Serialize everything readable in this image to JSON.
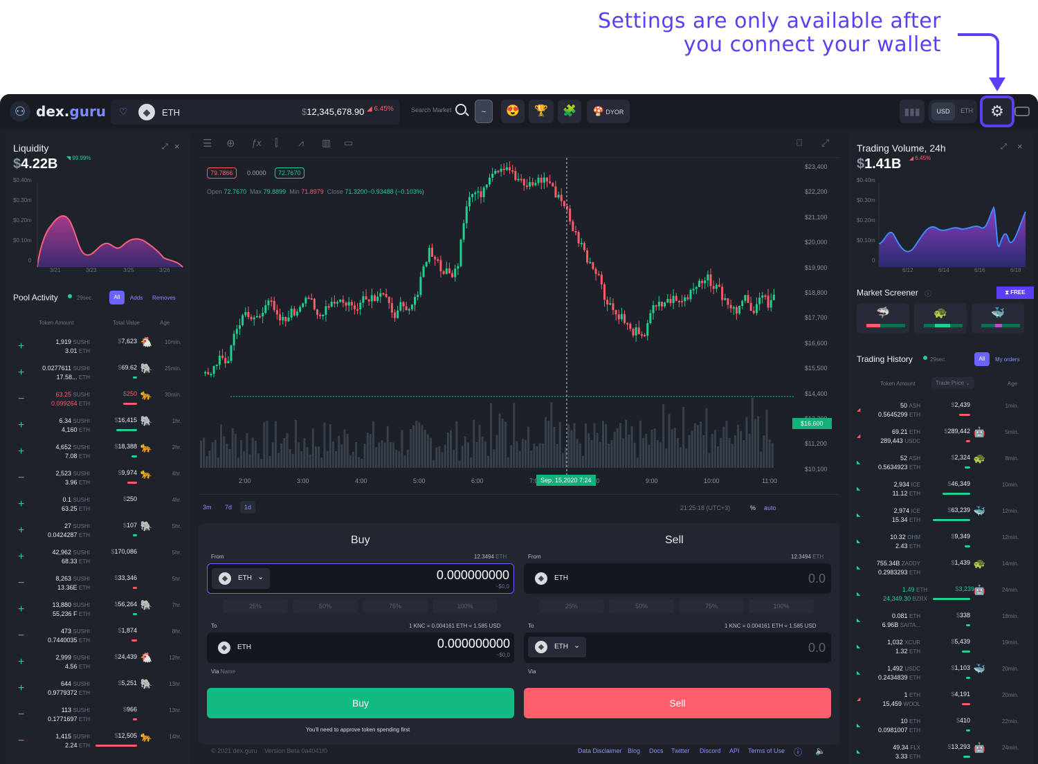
{
  "callout": {
    "line1": "Settings are only available after",
    "line2": "you connect your wallet"
  },
  "header": {
    "logo_a": "dex.",
    "logo_b": "guru",
    "token": "ETH",
    "price": "12,345,678.90",
    "price_prefix": "$",
    "change": "6.45%",
    "search": "Search Market",
    "dyor": "DYOR",
    "currencies": [
      "USD",
      "ETH"
    ]
  },
  "liquidity": {
    "title": "Liquidity",
    "value": "4.22B",
    "prefix": "$",
    "change": "99.99%",
    "yticks": [
      "$0.40m",
      "$0.30m",
      "$0.20m",
      "$0.10m",
      "0"
    ],
    "xticks": [
      "3/21",
      "3/23",
      "3/25",
      "3/26"
    ]
  },
  "pool": {
    "title": "Pool Activity",
    "interval": "29sec.",
    "filters": [
      "All",
      "Adds",
      "Removes"
    ],
    "cols": [
      "Token Amount",
      "Total Value",
      "Age"
    ],
    "rows": [
      {
        "s": "+",
        "a1": "1,919",
        "u1": "SUSHI",
        "a2": "3.01",
        "u2": "ETH",
        "v": "7,623",
        "age": "10min.",
        "ico": "🐔",
        "bar": 0
      },
      {
        "s": "+",
        "a1": "0.0277611",
        "u1": "SUSHI",
        "a2": "17.58...",
        "u2": "ETH",
        "v": "69.62",
        "age": "25min.",
        "ico": "🐘",
        "bar": 6
      },
      {
        "s": "−",
        "a1": "63.25",
        "u1": "SUSHI",
        "a2": "0.099264",
        "u2": "ETH",
        "v": "250",
        "age": "30min.",
        "ico": "🐆",
        "bar": 20,
        "red": true
      },
      {
        "s": "+",
        "a1": "6.34",
        "u1": "SUSHI",
        "a2": "4,160",
        "u2": "ETH",
        "v": "16,415",
        "age": "1hr.",
        "ico": "🐘",
        "bar": 30
      },
      {
        "s": "+",
        "a1": "4,652",
        "u1": "SUSHI",
        "a2": "7.08",
        "u2": "ETH",
        "v": "18,388",
        "age": "2hr.",
        "ico": "🐆",
        "bar": 8
      },
      {
        "s": "−",
        "a1": "2,523",
        "u1": "SUSHI",
        "a2": "3.96",
        "u2": "ETH",
        "v": "9,974",
        "age": "4hr.",
        "ico": "🐆",
        "bar": 14
      },
      {
        "s": "+",
        "a1": "0.1",
        "u1": "SUSHI",
        "a2": "63.25",
        "u2": "ETH",
        "v": "250",
        "age": "4hr.",
        "ico": "",
        "bar": 0
      },
      {
        "s": "+",
        "a1": "27",
        "u1": "SUSHI",
        "a2": "0.0424287",
        "u2": "ETH",
        "v": "107",
        "age": "5hr.",
        "ico": "🐘",
        "bar": 6
      },
      {
        "s": "+",
        "a1": "42,962",
        "u1": "SUSHI",
        "a2": "68.33",
        "u2": "ETH",
        "v": "170,086",
        "age": "5hr.",
        "ico": "",
        "bar": 0
      },
      {
        "s": "−",
        "a1": "8,263",
        "u1": "SUSHI",
        "a2": "13.36E",
        "u2": "ETH",
        "v": "33,346",
        "age": "5hr.",
        "ico": "",
        "bar": 6
      },
      {
        "s": "+",
        "a1": "13,880",
        "u1": "SUSHI",
        "a2": "55,236 F",
        "u2": "ETH",
        "v": "56,264",
        "age": "7hr.",
        "ico": "🐘",
        "bar": 6
      },
      {
        "s": "−",
        "a1": "473",
        "u1": "SUSHI",
        "a2": "0.7440035",
        "u2": "ETH",
        "v": "1,874",
        "age": "8hr.",
        "ico": "",
        "bar": 8
      },
      {
        "s": "+",
        "a1": "2,999",
        "u1": "SUSHI",
        "a2": "4.56",
        "u2": "ETH",
        "v": "24,439",
        "age": "12hr.",
        "ico": "🐔",
        "bar": 0
      },
      {
        "s": "+",
        "a1": "644",
        "u1": "SUSHI",
        "a2": "0.9779372",
        "u2": "ETH",
        "v": "5,251",
        "age": "13hr.",
        "ico": "🐘",
        "bar": 0
      },
      {
        "s": "−",
        "a1": "113",
        "u1": "SUSHI",
        "a2": "0.1771697",
        "u2": "ETH",
        "v": "966",
        "age": "13hr.",
        "ico": "",
        "bar": 6
      },
      {
        "s": "−",
        "a1": "1,415",
        "u1": "SUSHI",
        "a2": "2.24",
        "u2": "ETH",
        "v": "12,505",
        "age": "14hr.",
        "ico": "🐆",
        "bar": 60
      }
    ]
  },
  "chart": {
    "ohlc_tags": [
      "79.7866",
      "0.0000",
      "72.7670"
    ],
    "open_l": "Open",
    "open": "72.7670",
    "max_l": "Max",
    "max": "79.8899",
    "min_l": "Min",
    "min": "71.8979",
    "close_l": "Close",
    "close": "71.3200−0.93488 (−0.103%)",
    "yticks": [
      "$23,400",
      "$22,200",
      "$21,100",
      "$20,000",
      "$19,900",
      "$18,800",
      "$17,700",
      "$16,600",
      "$15,500",
      "$14,400",
      "$13,300",
      "$11,200",
      "$10,100"
    ],
    "xticks": [
      "2:00",
      "3:00",
      "4:00",
      "5:00",
      "6:00",
      "7:00",
      "8:00",
      "9:00",
      "10:00",
      "11:00"
    ],
    "cursor_price": "$16,600",
    "cursor_date": "Sep. 15,2020 7:24",
    "ranges": [
      "3m",
      "7d",
      "1d"
    ],
    "time": "21:25:18 (UTC+3)",
    "pct": "%",
    "auto": "auto"
  },
  "buy": {
    "title": "Buy",
    "from": "From",
    "bal": "12.3494",
    "bal_u": "ETH",
    "token": "ETH",
    "amount": "0.000000000",
    "usd": "~$0,0",
    "pcts": [
      "25%",
      "50%",
      "75%",
      "100%"
    ],
    "to": "To",
    "rate": "1 KNC = 0.004161 ETH = 1.585 USD",
    "via": "Via",
    "via_name": "Name",
    "btn": "Buy",
    "note": "You'll need to approve token spending first"
  },
  "sell": {
    "title": "Sell",
    "from": "From",
    "bal": "12.3494",
    "bal_u": "ETH",
    "token": "ETH",
    "amount": "0.0",
    "to": "To",
    "rate": "1 KNC = 0.004161 ETH = 1.585 USD",
    "via": "Via",
    "btn": "Sell"
  },
  "footer": {
    "copy": "© 2021 dex.guru",
    "version": "Version Beta 0a4041f0",
    "links": [
      "Data Disclaimer",
      "Blog",
      "Docs",
      "Twitter",
      "Discord",
      "API",
      "Terms of Use"
    ]
  },
  "volume": {
    "title": "Trading Volume, 24h",
    "value": "1.41B",
    "prefix": "$",
    "change": "6.45%",
    "yticks": [
      "$0.40m",
      "$0.30m",
      "$0.20m",
      "$0.10m",
      "0"
    ],
    "xticks": [
      "6/12",
      "6/14",
      "6/16",
      "6/18"
    ]
  },
  "screener": {
    "title": "Market Screener",
    "badge": "FREE"
  },
  "history": {
    "title": "Trading History",
    "interval": "29sec.",
    "filters": [
      "All",
      "My orders"
    ],
    "cols": [
      "Token Amount",
      "Trade Price",
      "Age"
    ],
    "rows": [
      {
        "a1": "50",
        "u1": "ASH",
        "a2": "0.5645299",
        "u2": "ETH",
        "v": "2,439",
        "age": "1min.",
        "ico": "",
        "bar": 16,
        "red": true
      },
      {
        "a1": "69.21",
        "u1": "ETH",
        "a2": "289,443",
        "u2": "USDC",
        "v": "289,442",
        "age": "5min.",
        "ico": "🤖",
        "bar": 6,
        "red": true
      },
      {
        "a1": "52",
        "u1": "ASH",
        "a2": "0.5634923",
        "u2": "ETH",
        "v": "2,324",
        "age": "8min.",
        "ico": "🐢",
        "bar": 8
      },
      {
        "a1": "2,934",
        "u1": "ICE",
        "a2": "11.12",
        "u2": "ETH",
        "v": "46,349",
        "age": "10min.",
        "ico": "",
        "bar": 40
      },
      {
        "a1": "2,974",
        "u1": "ICE",
        "a2": "15.34",
        "u2": "ETH",
        "v": "63,239",
        "age": "12min.",
        "ico": "🐳",
        "bar": 54
      },
      {
        "a1": "10.32",
        "u1": "OHM",
        "a2": "2.43",
        "u2": "ETH",
        "v": "9,349",
        "age": "12min.",
        "ico": "",
        "bar": 8
      },
      {
        "a1": "755.34B",
        "u1": "ZADDY",
        "a2": "0.2983293",
        "u2": "ETH",
        "v": "1,439",
        "age": "14min.",
        "ico": "🐢",
        "bar": 0
      },
      {
        "a1": "1.49",
        "u1": "ETH",
        "a2": "24,349.30",
        "u2": "BZRX",
        "v": "3,239",
        "age": "24min.",
        "ico": "🤖",
        "bar": 54,
        "green": true
      },
      {
        "a1": "0.081",
        "u1": "ETH",
        "a2": "6.96B",
        "u2": "SAITA...",
        "v": "338",
        "age": "18min.",
        "ico": "",
        "bar": 6
      },
      {
        "a1": "1,032",
        "u1": "XCUR",
        "a2": "1.32",
        "u2": "ETH",
        "v": "5,439",
        "age": "19min.",
        "ico": "",
        "bar": 12
      },
      {
        "a1": "1,492",
        "u1": "USDC",
        "a2": "0.2434839",
        "u2": "ETH",
        "v": "1,103",
        "age": "20min.",
        "ico": "🐳",
        "bar": 6
      },
      {
        "a1": "1",
        "u1": "ETH",
        "a2": "15,459",
        "u2": "WOOL",
        "v": "4,191",
        "age": "20min.",
        "ico": "",
        "bar": 12,
        "red": true
      },
      {
        "a1": "10",
        "u1": "ETH",
        "a2": "0.0981007",
        "u2": "ETH",
        "v": "410",
        "age": "22min.",
        "ico": "",
        "bar": 6
      },
      {
        "a1": "49.34",
        "u1": "FLX",
        "a2": "3.33",
        "u2": "ETH",
        "v": "13,293",
        "age": "24min.",
        "ico": "🤖",
        "bar": 10
      }
    ]
  }
}
